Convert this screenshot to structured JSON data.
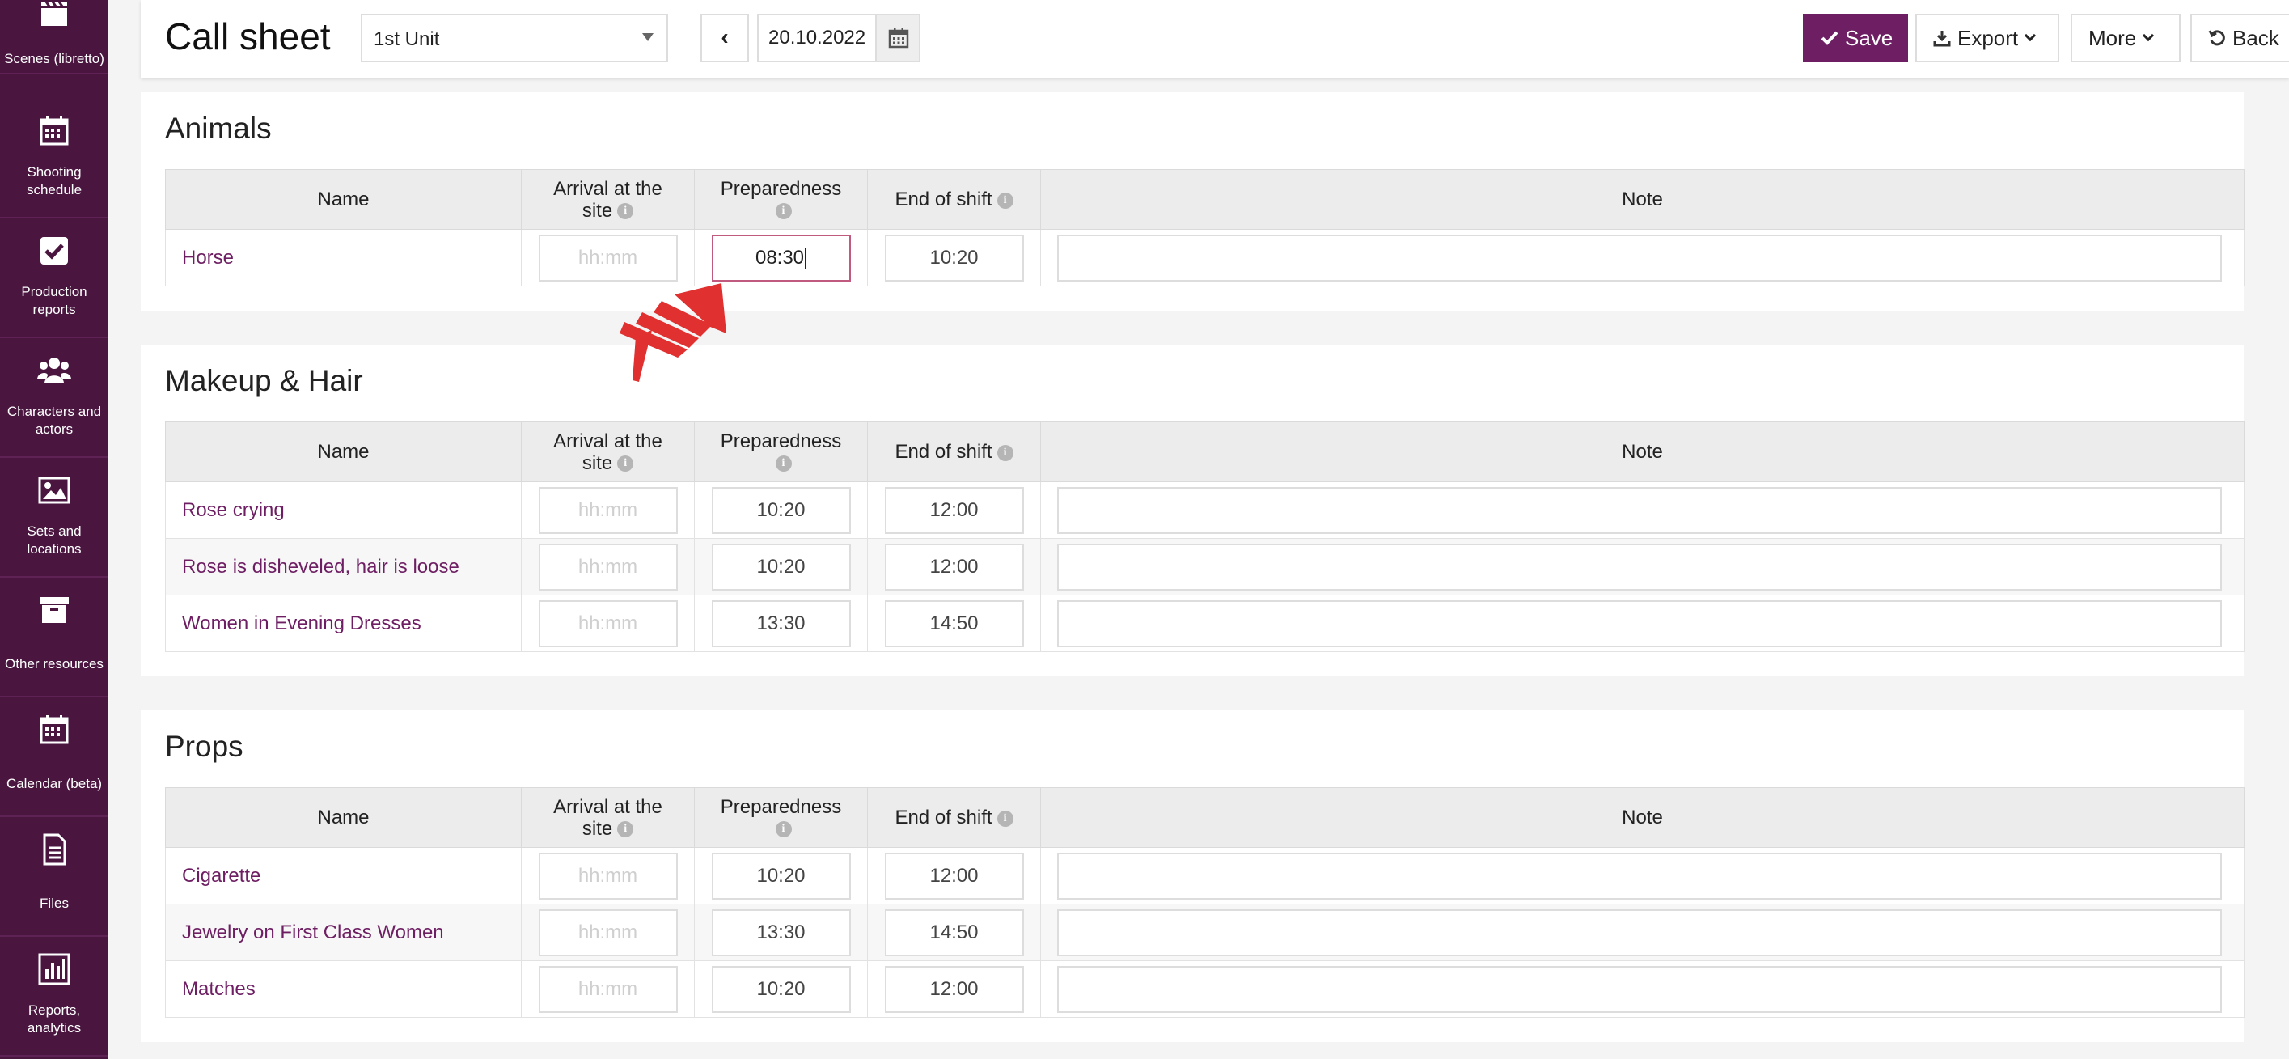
{
  "sidebar": {
    "items": [
      {
        "label": "Scenes (libretto)",
        "icon": "clapperboard-icon"
      },
      {
        "label": "Shooting schedule",
        "icon": "calendar-icon"
      },
      {
        "label": "Production reports",
        "icon": "check-square-icon"
      },
      {
        "label": "Characters and actors",
        "icon": "users-icon"
      },
      {
        "label": "Sets and locations",
        "icon": "image-icon"
      },
      {
        "label": "Other resources",
        "icon": "archive-icon"
      },
      {
        "label": "Calendar (beta)",
        "icon": "calendar-icon"
      },
      {
        "label": "Files",
        "icon": "file-icon"
      },
      {
        "label": "Reports, analytics",
        "icon": "bar-chart-icon"
      }
    ]
  },
  "header": {
    "title": "Call sheet",
    "unit_selected": "1st Unit",
    "prev_label": "‹",
    "date": "20.10.2022",
    "save_label": "Save",
    "export_label": "Export",
    "more_label": "More",
    "back_label": "Back"
  },
  "columns": {
    "name": "Name",
    "arrival_line1": "Arrival at the",
    "arrival_line2": "site",
    "preparedness": "Preparedness",
    "end_of_shift": "End of shift",
    "note": "Note",
    "info": "i"
  },
  "placeholder_time": "hh:mm",
  "sections": [
    {
      "title": "Animals",
      "rows": [
        {
          "name": "Horse",
          "arrival": "",
          "preparedness": "08:30",
          "end": "10:20",
          "note": ""
        }
      ]
    },
    {
      "title": "Makeup & Hair",
      "rows": [
        {
          "name": "Rose crying",
          "arrival": "",
          "preparedness": "10:20",
          "end": "12:00",
          "note": ""
        },
        {
          "name": "Rose is disheveled, hair is loose",
          "arrival": "",
          "preparedness": "10:20",
          "end": "12:00",
          "note": ""
        },
        {
          "name": "Women in Evening Dresses",
          "arrival": "",
          "preparedness": "13:30",
          "end": "14:50",
          "note": ""
        }
      ]
    },
    {
      "title": "Props",
      "rows": [
        {
          "name": "Cigarette",
          "arrival": "",
          "preparedness": "10:20",
          "end": "12:00",
          "note": ""
        },
        {
          "name": "Jewelry on First Class Women",
          "arrival": "",
          "preparedness": "13:30",
          "end": "14:50",
          "note": ""
        },
        {
          "name": "Matches",
          "arrival": "",
          "preparedness": "10:20",
          "end": "12:00",
          "note": ""
        }
      ]
    }
  ],
  "colors": {
    "sidebar_bg": "#4a1640",
    "accent": "#6e1f63",
    "cursor": "#e03030"
  }
}
